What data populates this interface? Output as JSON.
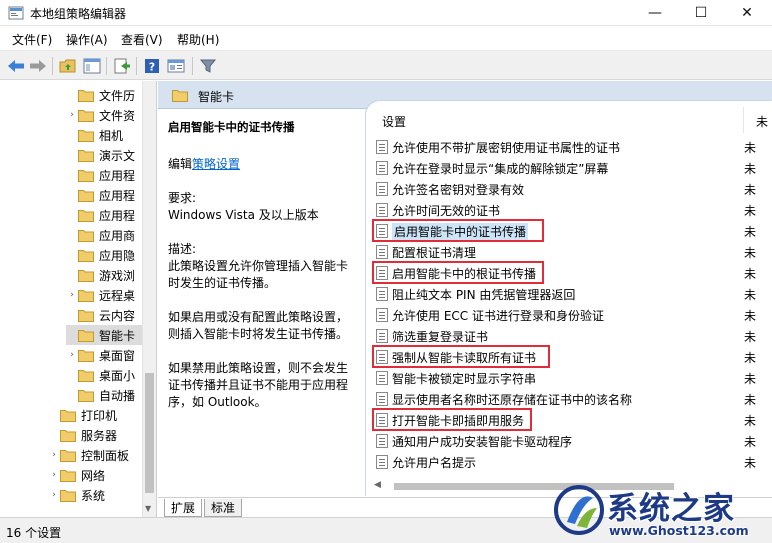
{
  "window": {
    "title": "本地组策略编辑器",
    "minimize": "—",
    "maximize": "☐",
    "close": "✕"
  },
  "menu": [
    "文件(F)",
    "操作(A)",
    "查看(V)",
    "帮助(H)"
  ],
  "toolbar": {
    "icons": [
      "back-arrow-icon",
      "forward-arrow-icon",
      "up-folder-icon",
      "show-hide-tree-icon",
      "export-list-icon",
      "help-icon",
      "properties-icon",
      "filter-icon"
    ]
  },
  "tree": {
    "items": [
      {
        "label": "文件历",
        "arrow": ""
      },
      {
        "label": "文件资",
        "arrow": "›"
      },
      {
        "label": "相机",
        "arrow": ""
      },
      {
        "label": "演示文",
        "arrow": ""
      },
      {
        "label": "应用程",
        "arrow": ""
      },
      {
        "label": "应用程",
        "arrow": ""
      },
      {
        "label": "应用程",
        "arrow": ""
      },
      {
        "label": "应用商",
        "arrow": ""
      },
      {
        "label": "应用隐",
        "arrow": ""
      },
      {
        "label": "游戏浏",
        "arrow": ""
      },
      {
        "label": "远程桌",
        "arrow": "›"
      },
      {
        "label": "云内容",
        "arrow": ""
      },
      {
        "label": "智能卡",
        "arrow": ""
      },
      {
        "label": "桌面窗",
        "arrow": "›"
      },
      {
        "label": "桌面小",
        "arrow": ""
      },
      {
        "label": "自动播",
        "arrow": ""
      },
      {
        "label": "打印机",
        "arrow": ""
      },
      {
        "label": "服务器",
        "arrow": ""
      },
      {
        "label": "控制面板",
        "arrow": "›"
      },
      {
        "label": "网络",
        "arrow": "›"
      },
      {
        "label": "系统",
        "arrow": "›"
      }
    ],
    "selected_index": 12
  },
  "header": {
    "title": "智能卡"
  },
  "description": {
    "title": "启用智能卡中的证书传播",
    "edit_prefix": "编辑",
    "edit_link": "策略设置",
    "req_label": "要求:",
    "req_value": "Windows Vista 及以上版本",
    "desc_label": "描述:",
    "desc_text": "此策略设置允许你管理插入智能卡时发生的证书传播。",
    "enable_text": "如果启用或没有配置此策略设置，则插入智能卡时将发生证书传播。",
    "disable_text": "如果禁用此策略设置，则不会发生证书传播并且证书不能用于应用程序，如 Outlook。"
  },
  "list": {
    "col_setting": "设置",
    "col_state": "未",
    "items": [
      {
        "label": "允许使用不带扩展密钥使用证书属性的证书",
        "state": "未"
      },
      {
        "label": "允许在登录时显示“集成的解除锁定”屏幕",
        "state": "未"
      },
      {
        "label": "允许签名密钥对登录有效",
        "state": "未"
      },
      {
        "label": "允许时间无效的证书",
        "state": "未"
      },
      {
        "label": "启用智能卡中的证书传播",
        "state": "未"
      },
      {
        "label": "配置根证书清理",
        "state": "未"
      },
      {
        "label": "启用智能卡中的根证书传播",
        "state": "未"
      },
      {
        "label": "阻止纯文本 PIN 由凭据管理器返回",
        "state": "未"
      },
      {
        "label": "允许使用 ECC 证书进行登录和身份验证",
        "state": "未"
      },
      {
        "label": "筛选重复登录证书",
        "state": "未"
      },
      {
        "label": "强制从智能卡读取所有证书",
        "state": "未"
      },
      {
        "label": "智能卡被锁定时显示字符串",
        "state": "未"
      },
      {
        "label": "显示使用者名称时还原存储在证书中的该名称",
        "state": "未"
      },
      {
        "label": "打开智能卡即插即用服务",
        "state": "未"
      },
      {
        "label": "通知用户成功安装智能卡驱动程序",
        "state": "未"
      },
      {
        "label": "允许用户名提示",
        "state": "未"
      }
    ],
    "selected_index": 4
  },
  "tabs": [
    "扩展",
    "标准"
  ],
  "status": {
    "text": "16 个设置"
  },
  "watermark": {
    "title": "系统之家",
    "url": "www.Ghost123.com"
  },
  "colors": {
    "header_strip": "#d6e2f0",
    "highlight_box": "#e12d39",
    "link": "#0066cc",
    "watermark": "#1d3a86"
  }
}
